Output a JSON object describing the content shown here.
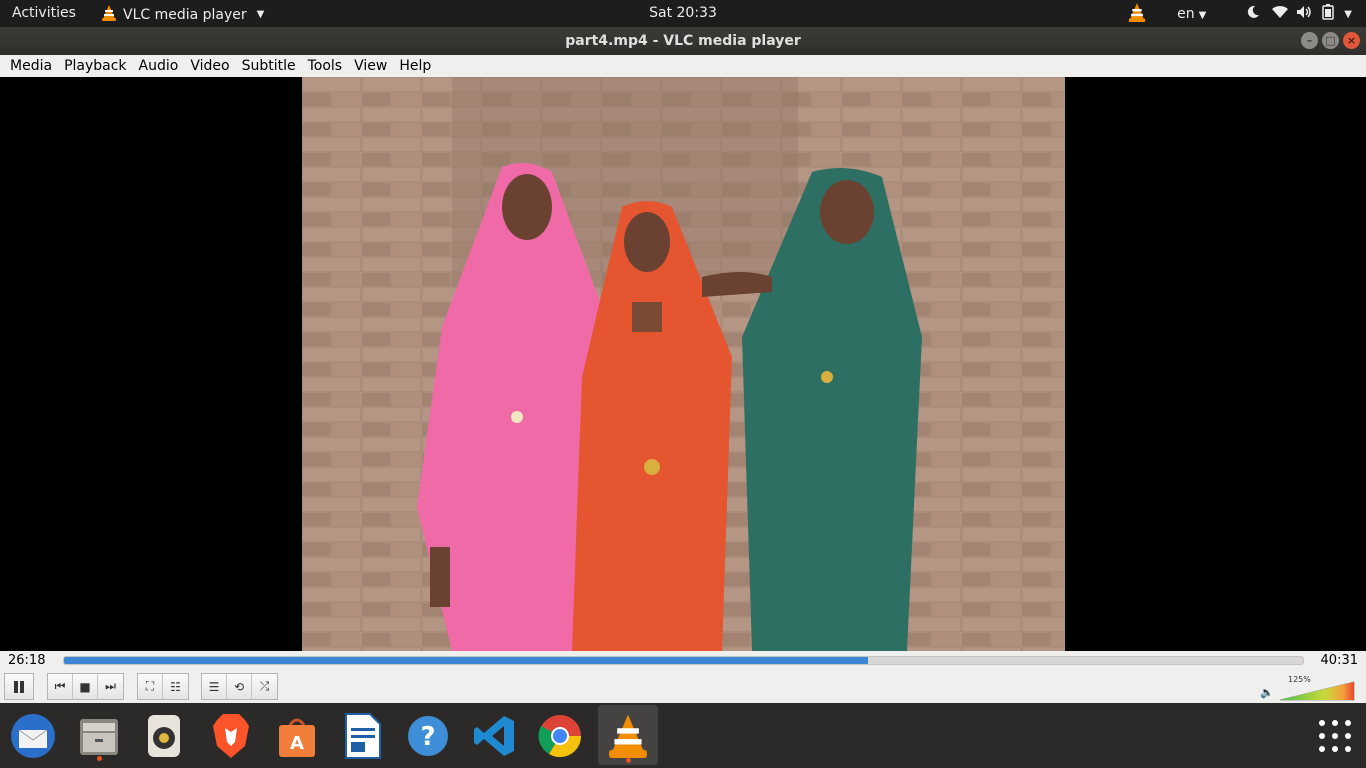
{
  "topbar": {
    "activities": "Activities",
    "app_name": "VLC media player",
    "clock": "Sat 20:33",
    "language": "en"
  },
  "window": {
    "title": "part4.mp4 - VLC media player"
  },
  "menubar": {
    "items": [
      "Media",
      "Playback",
      "Audio",
      "Video",
      "Subtitle",
      "Tools",
      "View",
      "Help"
    ]
  },
  "player": {
    "current_time": "26:18",
    "total_time": "40:31",
    "progress_fraction": 0.649,
    "volume_label": "125%",
    "volume_fraction": 1.0
  },
  "dock": {
    "apps": [
      "thunderbird-icon",
      "files-icon",
      "rhythmbox-icon",
      "brave-icon",
      "software-center-icon",
      "libreoffice-writer-icon",
      "help-icon",
      "vscode-icon",
      "chrome-icon",
      "vlc-icon"
    ]
  },
  "colors": {
    "accent_orange": "#e95420",
    "progress_blue": "#3d86d6",
    "vlc_orange": "#f28c00"
  }
}
